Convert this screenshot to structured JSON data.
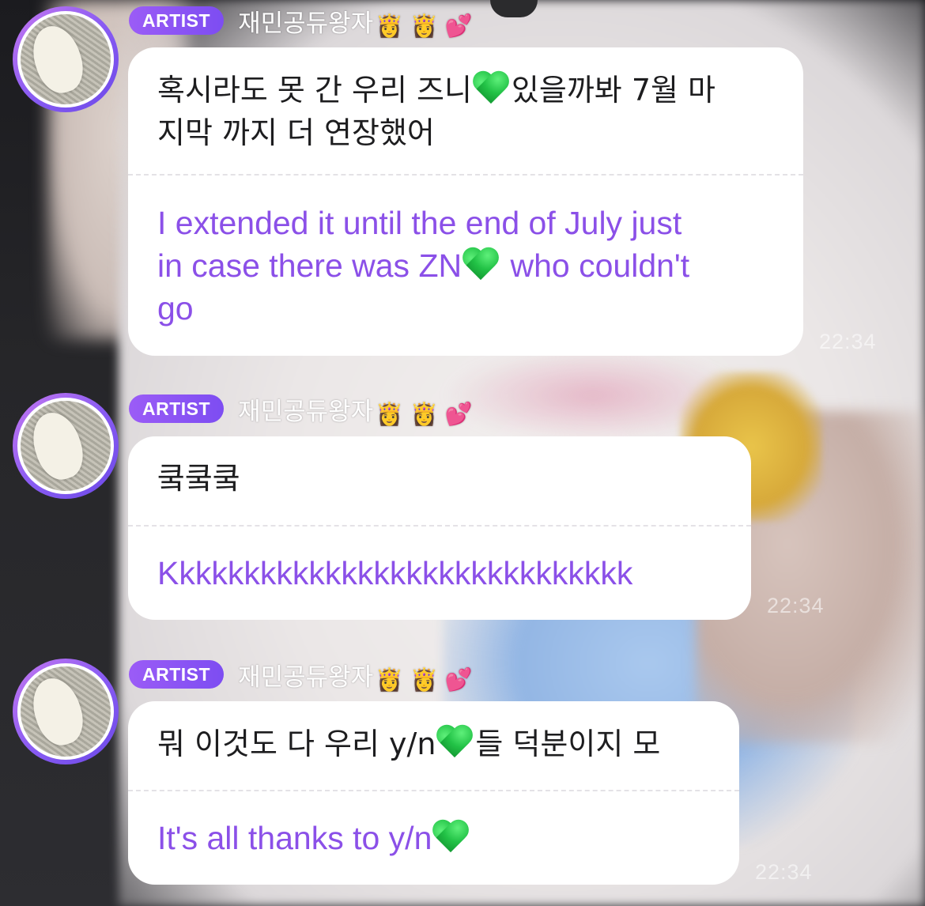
{
  "messages": [
    {
      "badge": "ARTIST",
      "nickname": "재민공듀왕자",
      "nickname_emojis": "👸 👸 💕",
      "korean_line1": "혹시라도 못 간 우리 즈니",
      "korean_line1_after": "있을까봐 7월 마",
      "korean_line2": "지막 까지 더 연장했어",
      "english_line1": "I extended it until the end of July just",
      "english_line2_before": "in case there was ZN",
      "english_line2_after": " who couldn't",
      "english_line3": "go",
      "time": "22:34"
    },
    {
      "badge": "ARTIST",
      "nickname": "재민공듀왕자",
      "nickname_emojis": "👸 👸 💕",
      "korean_line1": "쿸쿸쿸",
      "english_line1": "Kkkkkkkkkkkkkkkkkkkkkkkkkkkkk",
      "time": "22:34"
    },
    {
      "badge": "ARTIST",
      "nickname": "재민공듀왕자",
      "nickname_emojis": "👸 👸 💕",
      "korean_line1": "뭐 이것도 다 우리 y/n",
      "korean_line1_after": "들 덕분이지 모",
      "english_line1": "It's all thanks to y/n",
      "time": "22:34"
    }
  ],
  "colors": {
    "badge": "#8b55f4",
    "translation_text": "#8b50e8",
    "heart": "#22c246"
  },
  "icons": {
    "heart": "green-heart-icon",
    "avatar": "cat-avatar"
  }
}
